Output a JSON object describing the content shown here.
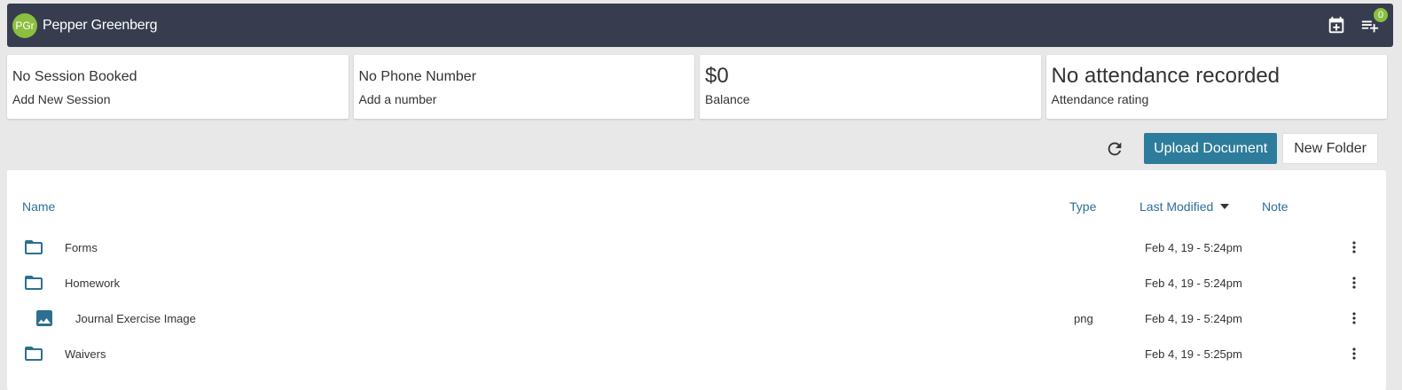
{
  "header": {
    "avatar_initials": "PGr",
    "client_name": "Pepper Greenberg",
    "calendar_icon": "calendar-add-icon",
    "queue_icon": "playlist-add-icon",
    "queue_badge": "0"
  },
  "cards": [
    {
      "title": "No Session Booked",
      "subtitle": "Add New Session"
    },
    {
      "title": "No Phone Number",
      "subtitle": "Add a number"
    },
    {
      "title": "$0",
      "subtitle": "Balance"
    },
    {
      "title": "No attendance recorded",
      "subtitle": "Attendance rating"
    }
  ],
  "actions": {
    "refresh_icon": "refresh-icon",
    "upload_label": "Upload Document",
    "new_folder_label": "New Folder"
  },
  "table": {
    "columns": {
      "name": "Name",
      "type": "Type",
      "modified": "Last Modified",
      "note": "Note"
    },
    "rows": [
      {
        "icon": "folder-icon",
        "name": "Forms",
        "type": "",
        "modified": "Feb 4, 19 - 5:24pm",
        "note": ""
      },
      {
        "icon": "folder-icon",
        "name": "Homework",
        "type": "",
        "modified": "Feb 4, 19 - 5:24pm",
        "note": ""
      },
      {
        "icon": "image-icon",
        "name": "Journal Exercise Image",
        "type": "png",
        "modified": "Feb 4, 19 - 5:24pm",
        "note": ""
      },
      {
        "icon": "folder-icon",
        "name": "Waivers",
        "type": "",
        "modified": "Feb 4, 19 - 5:25pm",
        "note": ""
      }
    ]
  },
  "colors": {
    "topbar": "#373d4f",
    "accent": "#2d7c9b",
    "avatar": "#8bbf3f",
    "link": "#2d6f99",
    "icon": "#2d6f8f"
  }
}
